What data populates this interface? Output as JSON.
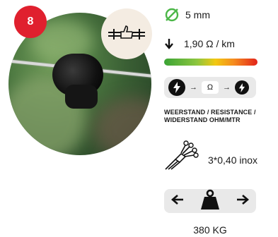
{
  "badge": {
    "number": "8",
    "color": "#e0202e"
  },
  "specs": {
    "diameter": {
      "icon": "diameter-icon",
      "value": "5 mm",
      "color": "#4cb748"
    },
    "resistance": {
      "icon": "arrow-down-icon",
      "value": "1,90 Ω / km"
    },
    "resistance_scale": {
      "colors": [
        "#3aa335",
        "#8cc63f",
        "#f2c811",
        "#f58a1f",
        "#e2231a"
      ]
    },
    "flow": {
      "ohm_label": "Ω",
      "arrow": "→"
    },
    "caption": "WEERSTAND / RESISTANCE / WIDERSTAND OHM/MTR",
    "conductors": {
      "icon": "conductor-wires-icon",
      "value": "3*0,40 inox"
    },
    "breaking_load": {
      "icon": "weight-icon",
      "left_arrow": "←",
      "right_arrow": "→",
      "value": "380 KG"
    }
  }
}
